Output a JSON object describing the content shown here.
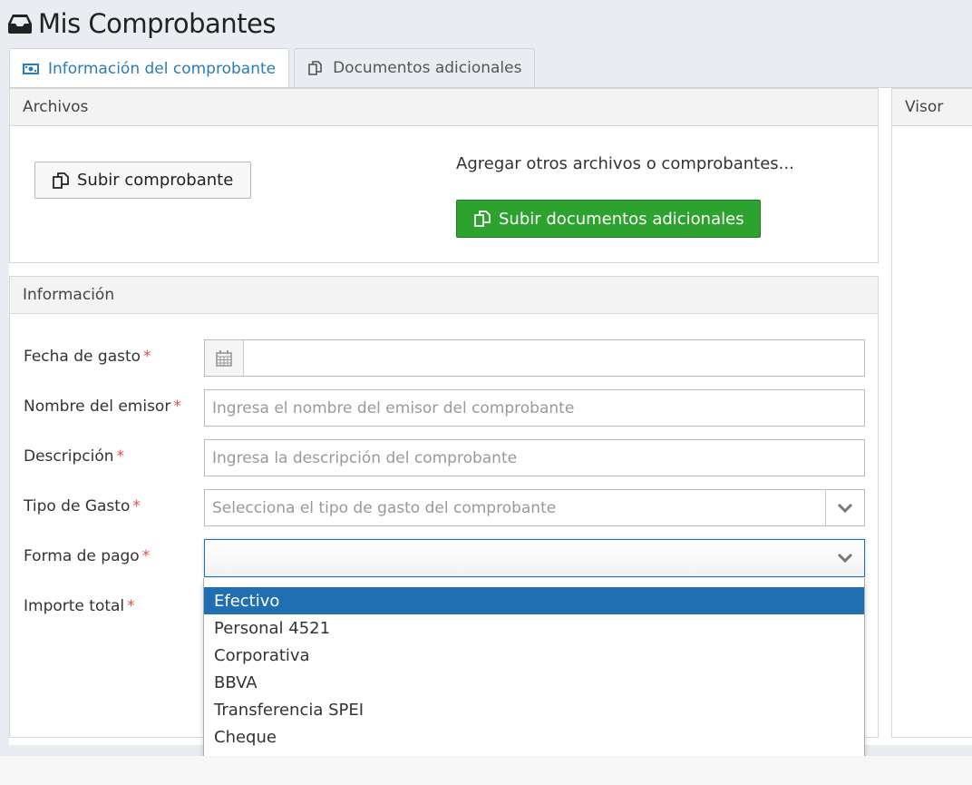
{
  "page": {
    "title": "Mis Comprobantes"
  },
  "tabs": [
    {
      "label": "Información del comprobante",
      "active": true
    },
    {
      "label": "Documentos adicionales",
      "active": false
    }
  ],
  "archivos": {
    "heading": "Archivos",
    "upload_label": "Subir comprobante",
    "extra_text": "Agregar otros archivos o comprobantes...",
    "extra_button_label": "Subir documentos adicionales"
  },
  "visor": {
    "heading": "Visor"
  },
  "informacion": {
    "heading": "Información",
    "fields": {
      "fecha": {
        "label": "Fecha de gasto",
        "required_mark": "*",
        "value": ""
      },
      "emisor": {
        "label": "Nombre del emisor",
        "required_mark": "*",
        "placeholder": "Ingresa el nombre del emisor del comprobante"
      },
      "descripcion": {
        "label": "Descripción",
        "required_mark": "*",
        "placeholder": "Ingresa la descripción del comprobante"
      },
      "tipo": {
        "label": "Tipo de Gasto",
        "required_mark": "*",
        "placeholder": "Selecciona el tipo de gasto del comprobante"
      },
      "forma_pago": {
        "label": "Forma de pago",
        "required_mark": "*",
        "value": ""
      },
      "importe": {
        "label": "Importe total",
        "required_mark": "*"
      }
    }
  },
  "forma_pago_dropdown": {
    "options": [
      "Efectivo",
      "Personal 4521",
      "Corporativa",
      "BBVA",
      "Transferencia SPEI",
      "Cheque"
    ],
    "highlighted": "Efectivo"
  },
  "colors": {
    "accent": "#2b7bb9",
    "success_button": "#2ea22e",
    "required": "#d9534f",
    "highlight": "#1f6fb2"
  },
  "icons": {
    "title": "inbox-tray-icon",
    "tab_info": "money-bill-icon",
    "tab_docs": "copy-documents-icon",
    "calendar": "calendar-icon",
    "chevron": "chevron-down-icon"
  }
}
